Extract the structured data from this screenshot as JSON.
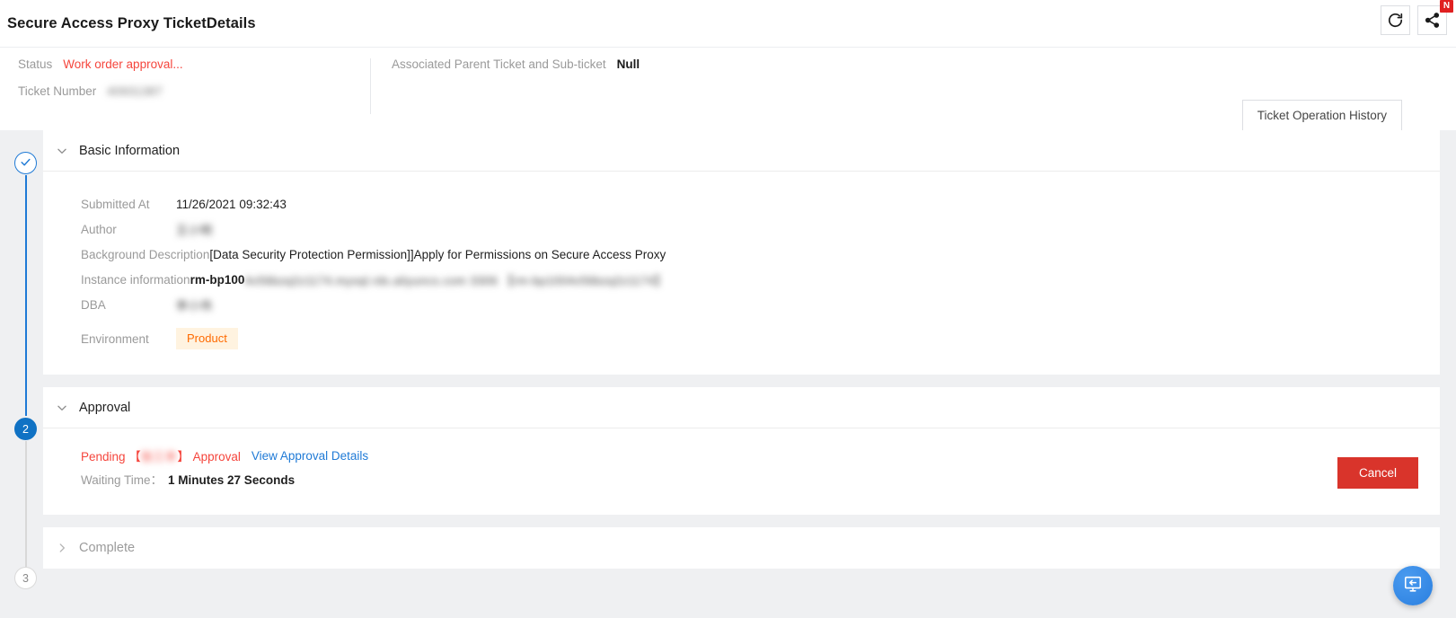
{
  "header": {
    "title": "Secure Access Proxy TicketDetails",
    "refresh_icon": "refresh-icon",
    "share_icon": "share-icon",
    "share_badge": "N"
  },
  "summary": {
    "status_label": "Status",
    "status_value": "Work order approval...",
    "ticket_number_label": "Ticket Number",
    "ticket_number_value": "40931387",
    "parent_ticket_label": "Associated Parent Ticket and Sub-ticket",
    "parent_ticket_value": "Null",
    "history_button": "Ticket Operation History"
  },
  "steps": [
    {
      "marker": "check-icon",
      "state": "done"
    },
    {
      "marker": "2",
      "state": "active"
    },
    {
      "marker": "3",
      "state": "todo"
    }
  ],
  "basic_information": {
    "title": "Basic Information",
    "chevron": "chevron-down-icon",
    "fields": [
      {
        "label": "Submitted At",
        "value": "11/26/2021 09:32:43",
        "blurred": false
      },
      {
        "label": "Author",
        "value": "王小明",
        "blurred": true
      },
      {
        "label": "Background Description",
        "value": "[Data Security Protection Permission]]Apply for Permissions on Secure Access Proxy",
        "blurred": false
      },
      {
        "label": "Instance information",
        "value": "rm-bp100",
        "value_blurred": "4v56bzq2z1174.mysql.rds.aliyuncs.com 3306 【rm-bp1004v56bzq2z1174】",
        "blurred": false
      },
      {
        "label": "DBA",
        "value": "李小伟",
        "blurred": true
      }
    ],
    "environment_label": "Environment",
    "environment_value": "Product"
  },
  "approval": {
    "title": "Approval",
    "chevron": "chevron-down-icon",
    "pending_prefix": "Pending 【",
    "pending_approver": "张三丰",
    "pending_suffix": "】 Approval",
    "view_details_link": "View Approval Details",
    "waiting_label": "Waiting Time：",
    "waiting_value": "1 Minutes 27 Seconds",
    "cancel_button": "Cancel"
  },
  "complete": {
    "title": "Complete",
    "chevron": "chevron-right-icon"
  },
  "fab": {
    "icon": "monitor-back-icon"
  },
  "colors": {
    "accent_blue": "#1f7ad6",
    "status_red": "#f5453c",
    "cancel_red": "#d9342b",
    "env_orange": "#ff6a00",
    "env_bg": "#fff3e0"
  }
}
